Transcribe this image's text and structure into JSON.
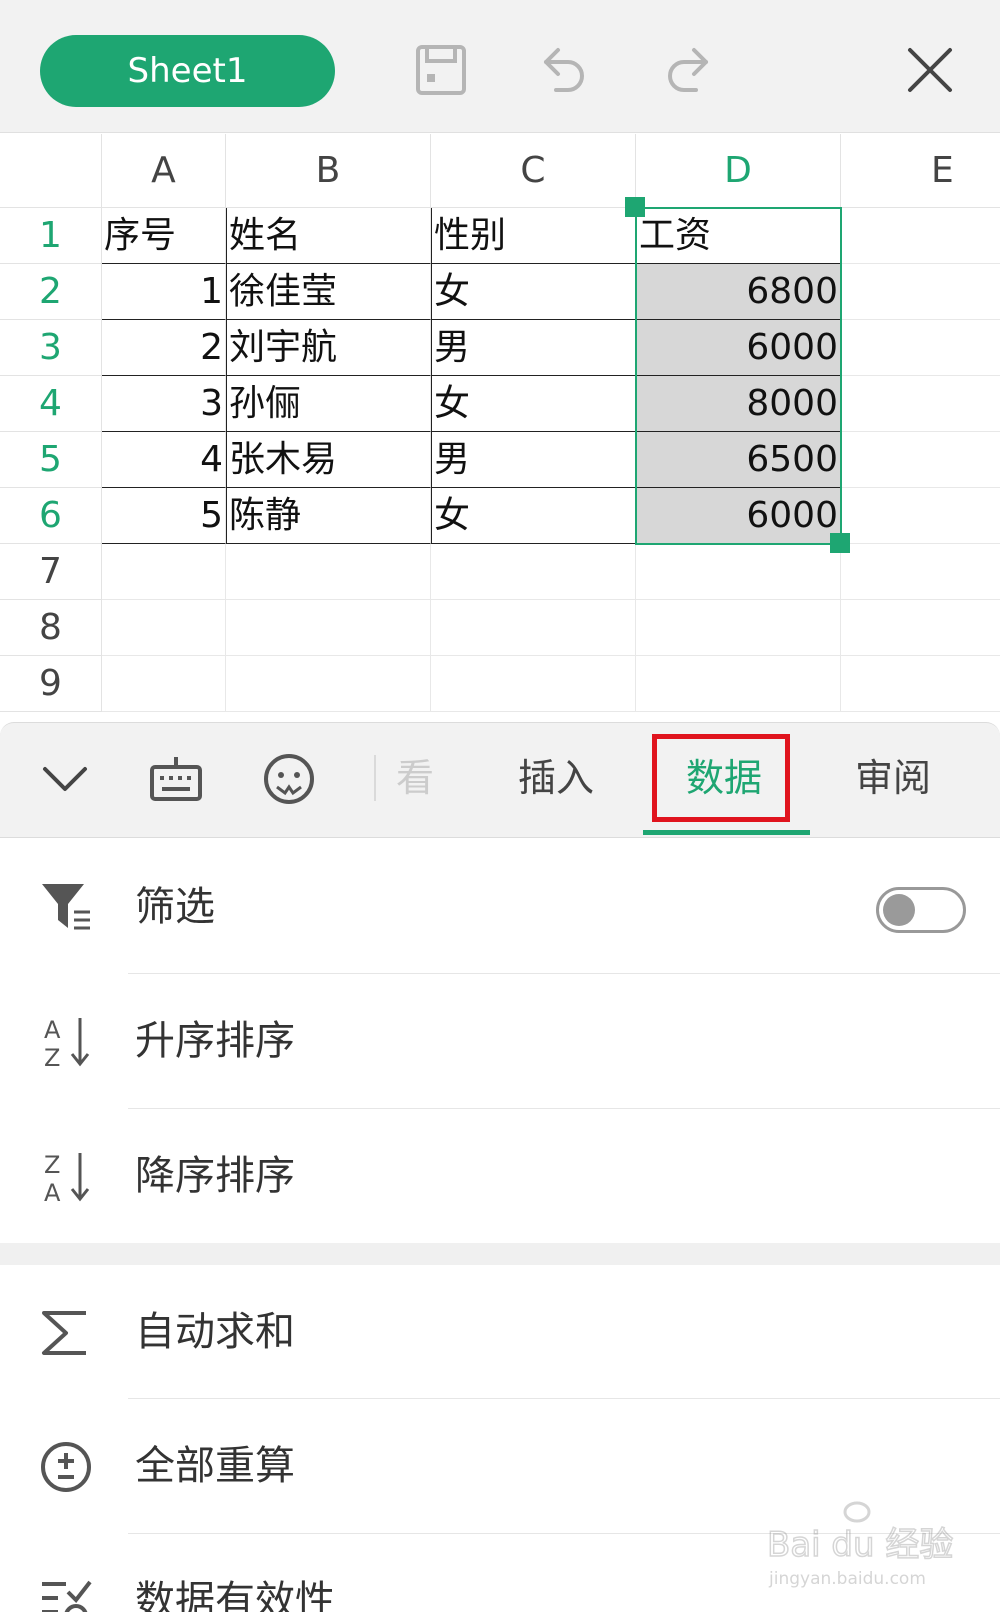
{
  "app": {
    "sheet_tab_label": "Sheet1"
  },
  "spreadsheet": {
    "columns": [
      "A",
      "B",
      "C",
      "D",
      "E"
    ],
    "active_column": "D",
    "rows": [
      "1",
      "2",
      "3",
      "4",
      "5",
      "6",
      "7",
      "8",
      "9"
    ],
    "active_rows": [
      "1",
      "2",
      "3",
      "4",
      "5",
      "6"
    ],
    "header_row": [
      "序号",
      "姓名",
      "性别",
      "工资"
    ],
    "data_rows": [
      {
        "no": "1",
        "name": "徐佳莹",
        "gender": "女",
        "salary": "6800"
      },
      {
        "no": "2",
        "name": "刘宇航",
        "gender": "男",
        "salary": "6000"
      },
      {
        "no": "3",
        "name": "孙俪",
        "gender": "女",
        "salary": "8000"
      },
      {
        "no": "4",
        "name": "张木易",
        "gender": "男",
        "salary": "6500"
      },
      {
        "no": "5",
        "name": "陈静",
        "gender": "女",
        "salary": "6000"
      }
    ]
  },
  "toolbar": {
    "tabs": [
      {
        "label": "看",
        "state": "faded"
      },
      {
        "label": "插入",
        "state": "normal"
      },
      {
        "label": "数据",
        "state": "active"
      },
      {
        "label": "审阅",
        "state": "normal"
      }
    ]
  },
  "menu": {
    "items": [
      {
        "label": "筛选",
        "icon": "filter-icon"
      },
      {
        "label": "升序排序",
        "icon": "sort-ascending-icon"
      },
      {
        "label": "降序排序",
        "icon": "sort-descending-icon"
      },
      {
        "label": "自动求和",
        "icon": "sigma-icon"
      },
      {
        "label": "全部重算",
        "icon": "recalculate-icon"
      },
      {
        "label": "数据有效性",
        "icon": "data-validation-icon"
      }
    ],
    "filter_toggle_on": false
  },
  "watermark": {
    "line1": "Bai du 经验",
    "line2": "jingyan.baidu.com"
  },
  "colors": {
    "accent": "#1ea672",
    "highlight": "#e0141e"
  }
}
